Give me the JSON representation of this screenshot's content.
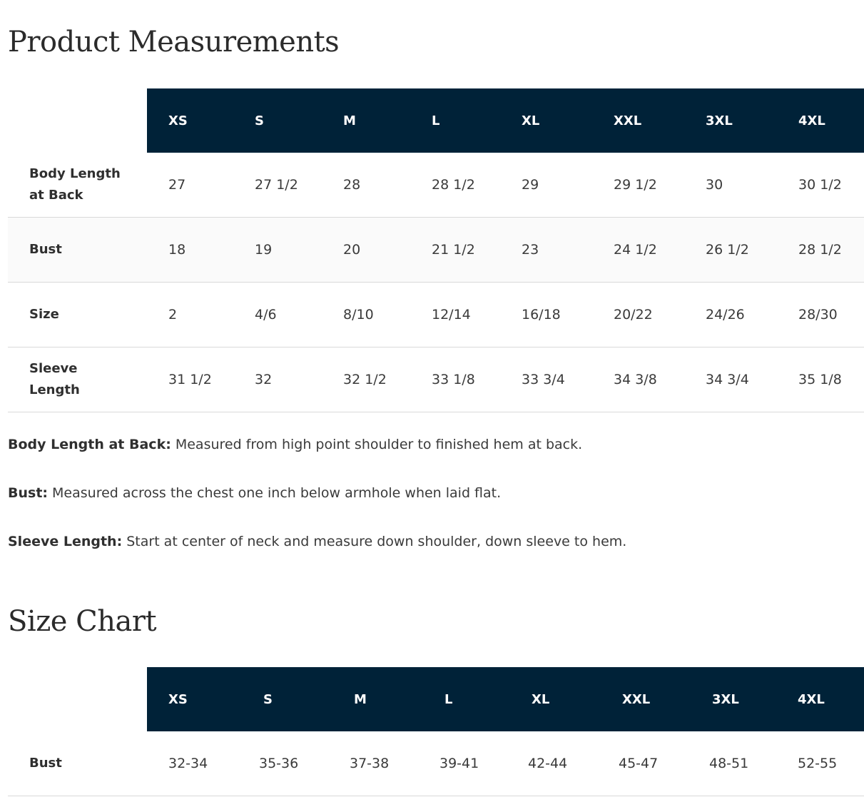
{
  "measurements": {
    "title": "Product Measurements",
    "sizes": [
      "XS",
      "S",
      "M",
      "L",
      "XL",
      "XXL",
      "3XL",
      "4XL"
    ],
    "rows": [
      {
        "label": "Body Length at Back",
        "values": [
          "27",
          "27 1/2",
          "28",
          "28 1/2",
          "29",
          "29 1/2",
          "30",
          "30 1/2"
        ]
      },
      {
        "label": "Bust",
        "values": [
          "18",
          "19",
          "20",
          "21 1/2",
          "23",
          "24 1/2",
          "26 1/2",
          "28 1/2"
        ]
      },
      {
        "label": "Size",
        "values": [
          "2",
          "4/6",
          "8/10",
          "12/14",
          "16/18",
          "20/22",
          "24/26",
          "28/30"
        ]
      },
      {
        "label": "Sleeve Length",
        "values": [
          "31 1/2",
          "32",
          "32 1/2",
          "33 1/8",
          "33 3/4",
          "34 3/8",
          "34 3/4",
          "35 1/8"
        ]
      }
    ],
    "notes": [
      {
        "term": "Body Length at Back:",
        "text": " Measured from high point shoulder to finished hem at back."
      },
      {
        "term": "Bust:",
        "text": " Measured across the chest one inch below armhole when laid flat."
      },
      {
        "term": "Sleeve Length:",
        "text": " Start at center of neck and measure down shoulder, down sleeve to hem."
      }
    ]
  },
  "size_chart": {
    "title": "Size Chart",
    "sizes": [
      "XS",
      "S",
      "M",
      "L",
      "XL",
      "XXL",
      "3XL",
      "4XL"
    ],
    "rows": [
      {
        "label": "Bust",
        "values": [
          "32-34",
          "35-36",
          "37-38",
          "39-41",
          "42-44",
          "45-47",
          "48-51",
          "52-55"
        ]
      }
    ]
  },
  "colors": {
    "header_bg": "#002238",
    "header_text": "#ffffff",
    "body_text": "#333333",
    "row_divider": "#d9d9d9"
  }
}
